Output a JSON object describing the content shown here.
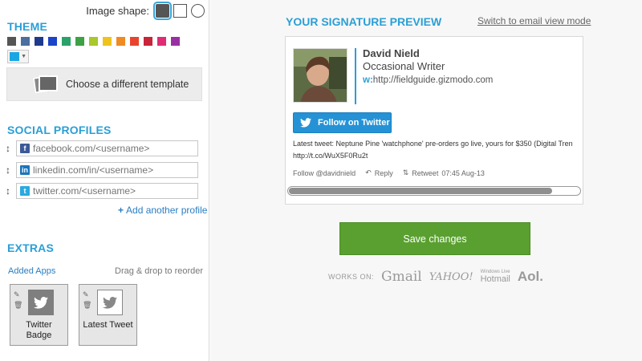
{
  "image_shape": {
    "label": "Image shape:",
    "options": [
      {
        "name": "rounded-square",
        "selected": true
      },
      {
        "name": "square",
        "selected": false
      },
      {
        "name": "circle",
        "selected": false
      }
    ]
  },
  "theme": {
    "title": "THEME",
    "swatches": [
      "#555555",
      "#4a6fa0",
      "#1e3a8c",
      "#1c44c8",
      "#2aa36a",
      "#3da146",
      "#a8c82b",
      "#f0c21e",
      "#f08a22",
      "#e8442d",
      "#c8243a",
      "#e02c74",
      "#9a2fa3"
    ],
    "selected_color": "#1aa6e4",
    "template_button": "Choose a different template"
  },
  "social": {
    "title": "SOCIAL PROFILES",
    "profiles": [
      {
        "network": "facebook",
        "icon": "facebook-icon",
        "badge": "f",
        "color": "#3b5998",
        "placeholder": "facebook.com/<username>"
      },
      {
        "network": "linkedin",
        "icon": "linkedin-icon",
        "badge": "in",
        "color": "#1b75bb",
        "placeholder": "linkedin.com/in/<username>"
      },
      {
        "network": "twitter",
        "icon": "twitter-icon",
        "badge": "t",
        "color": "#2aa9e0",
        "placeholder": "twitter.com/<username>"
      }
    ],
    "add_label": "Add another profile"
  },
  "extras": {
    "title": "EXTRAS",
    "added_apps_label": "Added Apps",
    "drag_note": "Drag & drop to reorder",
    "apps": [
      {
        "name": "Twitter Badge",
        "name_line1": "Twitter",
        "name_line2": "Badge"
      },
      {
        "name": "Latest Tweet",
        "name_line1": "Latest Tweet",
        "name_line2": ""
      }
    ]
  },
  "preview": {
    "title": "YOUR SIGNATURE PREVIEW",
    "switch_link": "Switch to email view mode",
    "name": "David Nield",
    "role": "Occasional Writer",
    "website_prefix": "w:",
    "website": "http://fieldguide.gizmodo.com",
    "follow_button": "Follow on Twitter",
    "latest_tweet_label": "Latest tweet:",
    "latest_tweet_text": "Neptune Pine 'watchphone' pre-orders go live, yours for $350 (Digital Tren",
    "latest_tweet_link": "http://t.co/WuX5F0Ru2t",
    "follow_handle": "Follow @davidnield",
    "reply_label": "Reply",
    "retweet_label": "Retweet",
    "timestamp": "07:45 Aug-13",
    "scroll_position": 0.9
  },
  "save_button": "Save changes",
  "works_on": {
    "label": "WORKS ON:",
    "clients": [
      {
        "name": "Gmail",
        "text": "Gmail"
      },
      {
        "name": "Yahoo Mail",
        "text": "YAHOO!"
      },
      {
        "name": "Windows Live Hotmail",
        "text": "Hotmail",
        "subtext": "Windows Live"
      },
      {
        "name": "Aol",
        "text": "Aol."
      }
    ]
  }
}
